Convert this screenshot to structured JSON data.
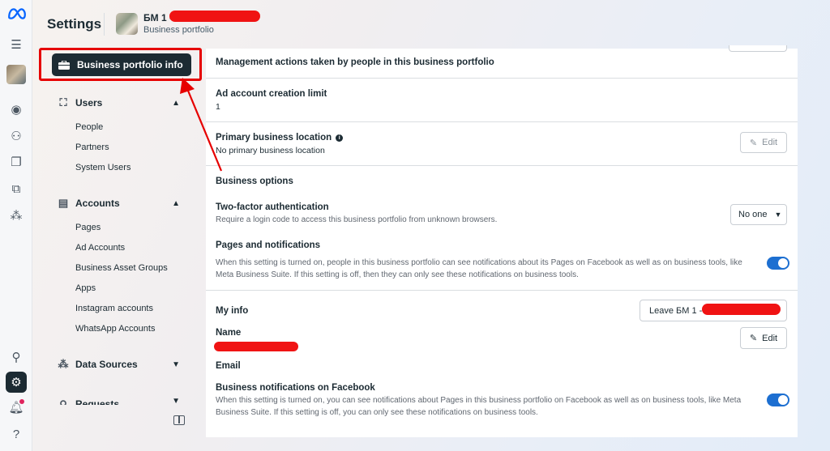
{
  "header": {
    "title": "Settings",
    "portfolio_name": "БМ 1 - К",
    "portfolio_subtitle": "Business portfolio"
  },
  "sidebar": {
    "active_item": "Business portfolio info",
    "sections": [
      {
        "label": "Users",
        "icon": "users-icon",
        "items": [
          "People",
          "Partners",
          "System Users"
        ]
      },
      {
        "label": "Accounts",
        "icon": "accounts-icon",
        "items": [
          "Pages",
          "Ad Accounts",
          "Business Asset Groups",
          "Apps",
          "Instagram accounts",
          "WhatsApp Accounts"
        ]
      },
      {
        "label": "Data Sources",
        "icon": "data-sources-icon",
        "items": []
      },
      {
        "label": "Requests",
        "icon": "requests-icon",
        "items": []
      }
    ]
  },
  "main": {
    "management_actions_label": "Management actions taken by people in this business portfolio",
    "ad_limit_label": "Ad account creation limit",
    "ad_limit_value": "1",
    "primary_location_label": "Primary business location",
    "primary_location_value": "No primary business location",
    "edit_label": "Edit",
    "business_options_heading": "Business options",
    "two_factor_label": "Two-factor authentication",
    "two_factor_desc": "Require a login code to access this business portfolio from unknown browsers.",
    "two_factor_value": "No one",
    "pages_notif_label": "Pages and notifications",
    "pages_notif_desc": "When this setting is turned on, people in this business portfolio can see notifications about its Pages on Facebook as well as on business tools, like Meta Business Suite. If this setting is off, then they can only see these notifications on business tools.",
    "pages_notif_on": true,
    "my_info_heading": "My info",
    "leave_button": "Leave БМ 1 - К",
    "name_label": "Name",
    "email_label": "Email",
    "biz_notif_label": "Business notifications on Facebook",
    "biz_notif_desc": "When this setting is turned on, you can see notifications about Pages in this business portfolio on Facebook as well as on business tools, like Meta Business Suite. If this setting is off, you can only see these notifications on business tools.",
    "biz_notif_on": true
  },
  "colors": {
    "accent": "#1d6fd1",
    "dark": "#1c2b33",
    "annotation_red": "#e60000"
  }
}
